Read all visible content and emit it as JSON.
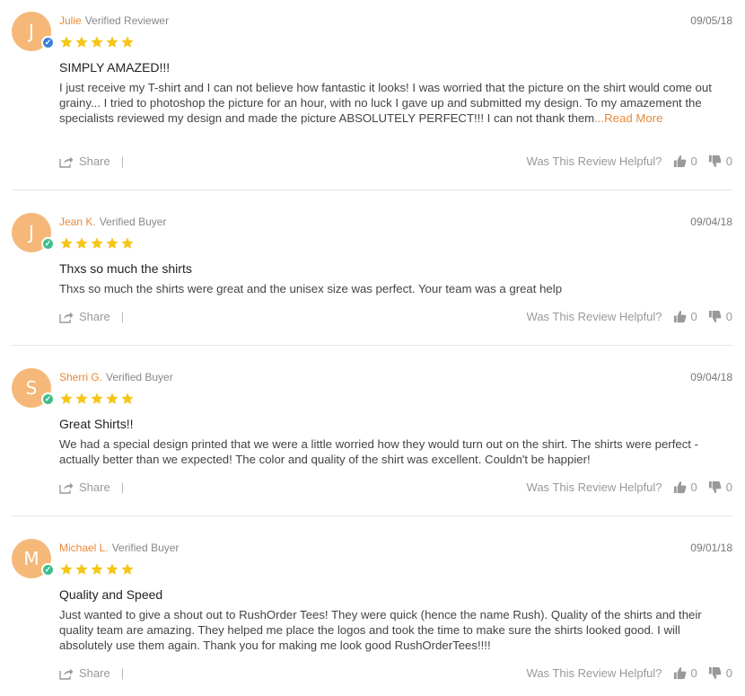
{
  "colors": {
    "accent": "#e8893a",
    "star": "#f5c518",
    "avatar": "#f5b878",
    "badge_blue": "#3b7fd9",
    "badge_green": "#3fbf8c"
  },
  "helpful_label": "Was This Review Helpful?",
  "share_label": "Share",
  "share_separator": "|",
  "reviews": [
    {
      "initial": "J",
      "badge_icon": "check-icon",
      "name": "Julie",
      "role": "Verified Reviewer",
      "date": "09/05/18",
      "rating": 5,
      "title": "SIMPLY AMAZED!!!",
      "body": "I just receive my T-shirt and I can not believe how fantastic it looks! I was worried that the picture on the shirt would come out grainy... I tried to photoshop the picture for an hour, with no luck I gave up and submitted my design. To my amazement the specialists reviewed my design and made the picture ABSOLUTELY PERFECT!!! I can not thank them",
      "read_more": "...Read More",
      "up": "0",
      "down": "0"
    },
    {
      "initial": "J",
      "badge_icon": "check-icon",
      "name": "Jean K.",
      "role": "Verified Buyer",
      "date": "09/04/18",
      "rating": 5,
      "title": "Thxs so much the shirts",
      "body": "Thxs so much the shirts were great and the unisex size was perfect. Your team was a great help",
      "up": "0",
      "down": "0"
    },
    {
      "initial": "S",
      "badge_icon": "check-icon",
      "name": "Sherri G.",
      "role": "Verified Buyer",
      "date": "09/04/18",
      "rating": 5,
      "title": "Great Shirts!!",
      "body": "We had a special design printed that we were a little worried how they would turn out on the shirt. The shirts were perfect - actually better than we expected! The color and quality of the shirt was excellent. Couldn't be happier!",
      "up": "0",
      "down": "0"
    },
    {
      "initial": "M",
      "badge_icon": "check-icon",
      "name": "Michael L.",
      "role": "Verified Buyer",
      "date": "09/01/18",
      "rating": 5,
      "title": "Quality and Speed",
      "body": "Just wanted to give a shout out to RushOrder Tees! They were quick (hence the name Rush). Quality of the shirts and their quality team are amazing. They helped me place the logos and took the time to make sure the shirts looked good. I will absolutely use them again. Thank you for making me look good RushOrderTees!!!!",
      "up": "0",
      "down": "0"
    }
  ]
}
